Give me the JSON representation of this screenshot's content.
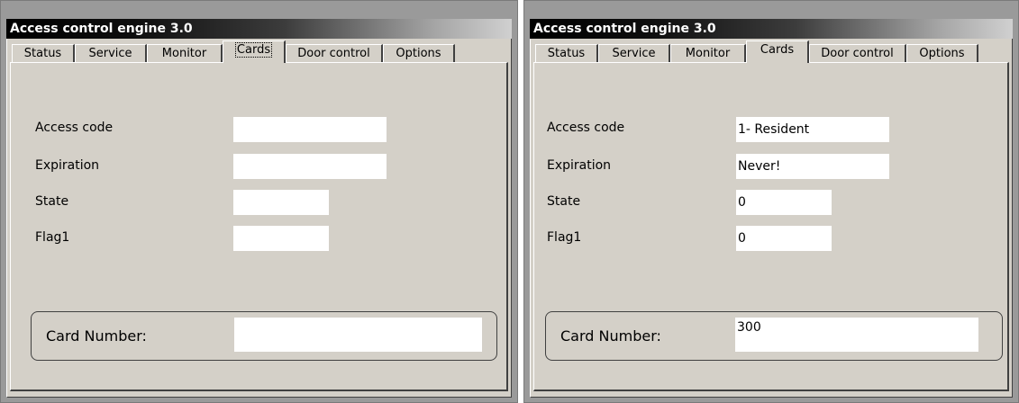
{
  "left": {
    "title": "Access control engine 3.0",
    "tabs": [
      "Status",
      "Service",
      "Monitor",
      "Cards",
      "Door control",
      "Options"
    ],
    "active_tab": "Cards",
    "fields": {
      "access_code": {
        "label": "Access code",
        "value": ""
      },
      "expiration": {
        "label": "Expiration",
        "value": ""
      },
      "state": {
        "label": "State",
        "value": ""
      },
      "flag1": {
        "label": "Flag1",
        "value": ""
      }
    },
    "card_number": {
      "label": "Card Number:",
      "value": ""
    }
  },
  "right": {
    "title": "Access control engine 3.0",
    "tabs": [
      "Status",
      "Service",
      "Monitor",
      "Cards",
      "Door control",
      "Options"
    ],
    "active_tab": "Cards",
    "fields": {
      "access_code": {
        "label": "Access code",
        "value": "1- Resident"
      },
      "expiration": {
        "label": "Expiration",
        "value": "Never!"
      },
      "state": {
        "label": "State",
        "value": "0"
      },
      "flag1": {
        "label": "Flag1",
        "value": "0"
      }
    },
    "card_number": {
      "label": "Card Number:",
      "value": "300"
    }
  }
}
